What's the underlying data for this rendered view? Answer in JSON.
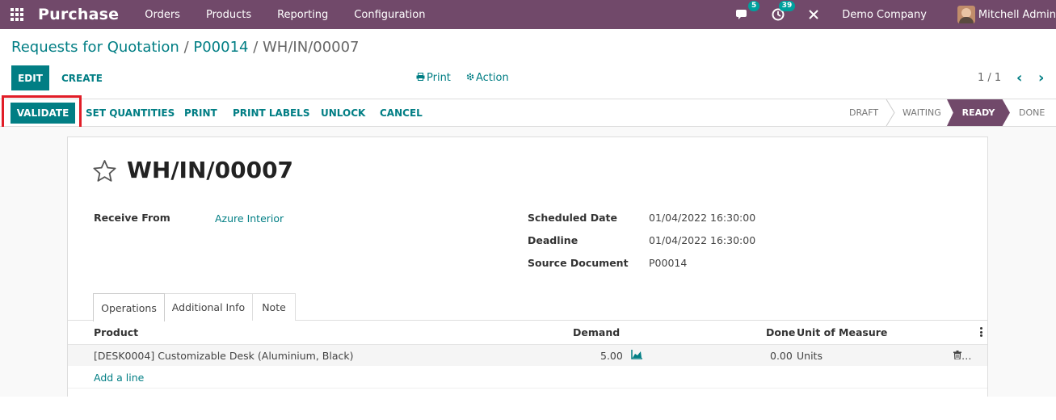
{
  "navbar": {
    "brand": "Purchase",
    "menu": [
      "Orders",
      "Products",
      "Reporting",
      "Configuration"
    ],
    "messages_count": "5",
    "activities_count": "39",
    "company": "Demo Company",
    "user": "Mitchell Admin"
  },
  "breadcrumb": {
    "root": "Requests for Quotation",
    "sep1": " / ",
    "parent": "P00014",
    "sep2": " / ",
    "current": "WH/IN/00007"
  },
  "control_panel": {
    "edit": "EDIT",
    "create": "CREATE",
    "print": "Print",
    "action": "Action",
    "pager": "1 / 1"
  },
  "header_buttons": {
    "validate": "VALIDATE",
    "set_quantities": "SET QUANTITIES",
    "print": "PRINT",
    "print_labels": "PRINT LABELS",
    "unlock": "UNLOCK",
    "cancel": "CANCEL"
  },
  "stages": {
    "draft": "DRAFT",
    "waiting": "WAITING",
    "ready": "READY",
    "done": "DONE",
    "current": "READY"
  },
  "record": {
    "title": "WH/IN/00007",
    "receive_from_label": "Receive From",
    "receive_from": "Azure Interior",
    "scheduled_date_label": "Scheduled Date",
    "scheduled_date": "01/04/2022 16:30:00",
    "deadline_label": "Deadline",
    "deadline": "01/04/2022 16:30:00",
    "source_document_label": "Source Document",
    "source_document": "P00014"
  },
  "tabs": [
    "Operations",
    "Additional Info",
    "Note"
  ],
  "operations": {
    "columns": {
      "product": "Product",
      "demand": "Demand",
      "done": "Done",
      "uom": "Unit of Measure"
    },
    "rows": [
      {
        "product": "[DESK0004] Customizable Desk (Aluminium, Black)",
        "demand": "5.00",
        "done": "0.00",
        "uom": "Units",
        "delete": "…"
      }
    ],
    "add_line": "Add a line"
  },
  "colors": {
    "navbar": "#71496a",
    "primary": "#017e84",
    "highlight": "#e11d27",
    "badge": "#00a09d"
  }
}
